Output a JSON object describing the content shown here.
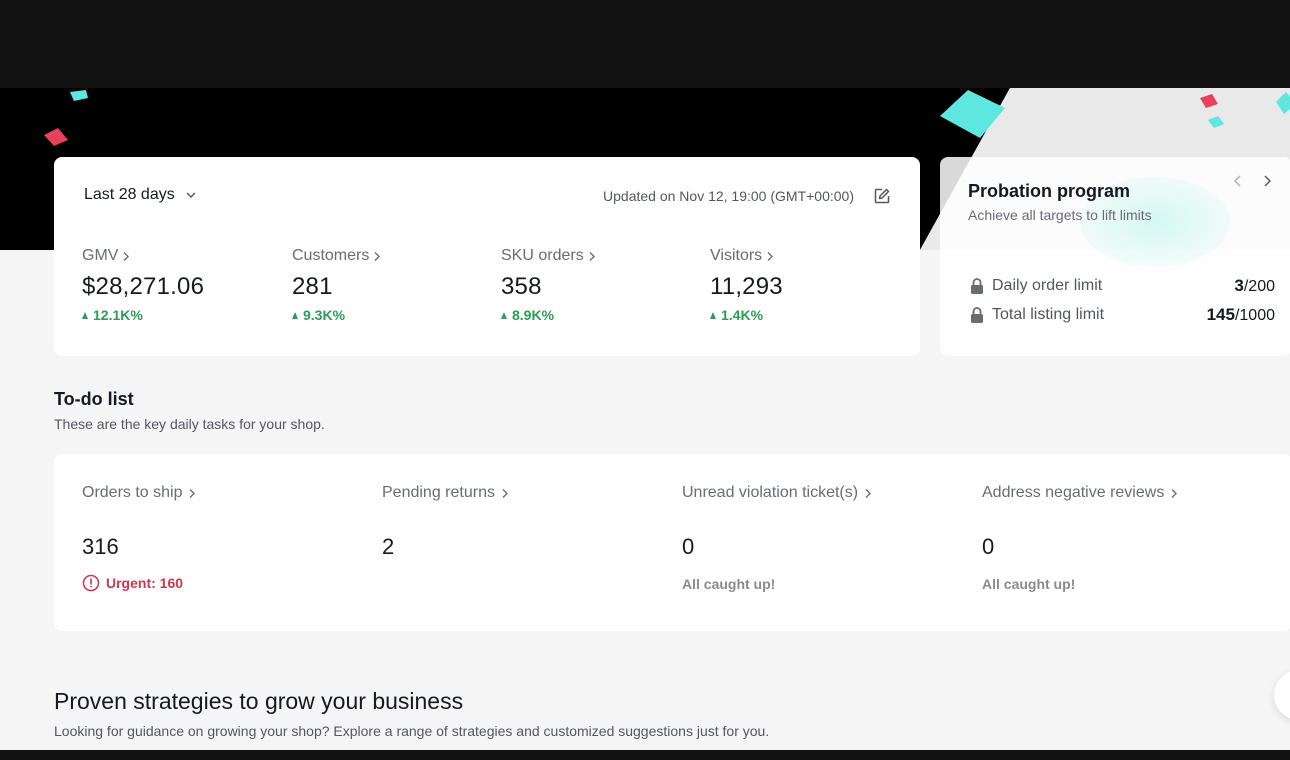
{
  "dashboard": {
    "range_label": "Last 28 days",
    "updated_text": "Updated on Nov 12, 19:00 (GMT+00:00)",
    "metrics": [
      {
        "label": "GMV",
        "value": "$28,271.06",
        "change": "12.1K%"
      },
      {
        "label": "Customers",
        "value": "281",
        "change": "9.3K%"
      },
      {
        "label": "SKU orders",
        "value": "358",
        "change": "8.9K%"
      },
      {
        "label": "Visitors",
        "value": "11,293",
        "change": "1.4K%"
      }
    ]
  },
  "probation": {
    "title": "Probation program",
    "subtitle": "Achieve all targets to lift limits",
    "limits": [
      {
        "label": "Daily order limit",
        "current": "3",
        "max": "/200"
      },
      {
        "label": "Total listing limit",
        "current": "145",
        "max": "/1000"
      }
    ]
  },
  "todo": {
    "title": "To-do list",
    "subtitle": "These are the key daily tasks for your shop.",
    "items": [
      {
        "label": "Orders to ship",
        "value": "316",
        "note": "Urgent: 160"
      },
      {
        "label": "Pending returns",
        "value": "2",
        "note": ""
      },
      {
        "label": "Unread violation ticket(s)",
        "value": "0",
        "note": "All caught up!"
      },
      {
        "label": "Address negative reviews",
        "value": "0",
        "note": "All caught up!"
      }
    ]
  },
  "strategies": {
    "title": "Proven strategies to grow your business",
    "subtitle": "Looking for guidance on growing your shop? Explore a range of strategies and customized suggestions just for you."
  },
  "colors": {
    "positive": "#2a9d56",
    "urgent": "#c7394b",
    "confetti_cyan": "#5ee6e0",
    "confetti_red": "#e8415a"
  },
  "icons": [
    "chevron-down-icon",
    "edit-icon",
    "chevron-right-icon",
    "arrow-up-icon",
    "lock-icon",
    "alert-circle-icon",
    "chevron-left-icon"
  ]
}
